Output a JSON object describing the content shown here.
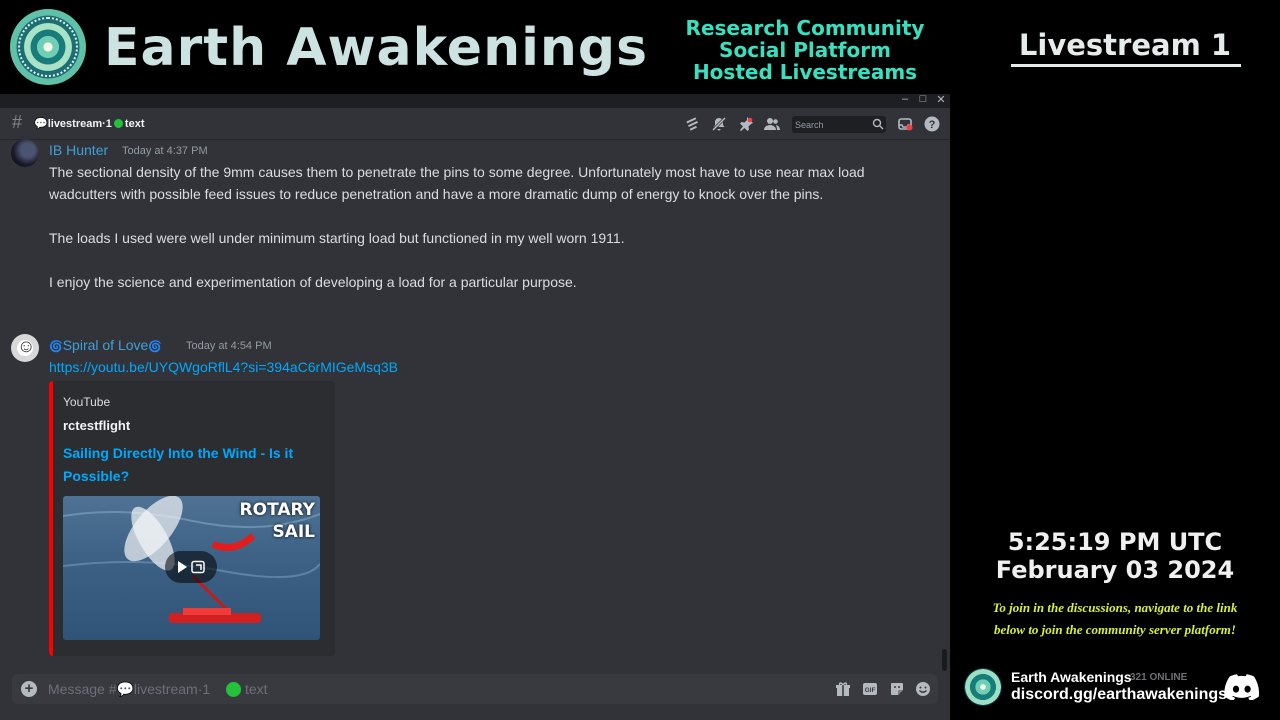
{
  "banner": {
    "brand": "Earth Awakenings",
    "tagline": [
      "Research Community",
      "Social Platform",
      "Hosted Livestreams"
    ]
  },
  "side": {
    "livestream_title": "Livestream 1",
    "time": "5:25:19 PM UTC",
    "date": "February 03 2024",
    "join_line1": "To join in the discussions, navigate to the link",
    "join_line2": "below to join the community server platform!",
    "invite": {
      "server_name": "Earth Awakenings",
      "online": "321 ONLINE",
      "url": "discord.gg/earthawakenings"
    }
  },
  "window_controls": [
    "–",
    "□",
    "✕"
  ],
  "header": {
    "channel_name": "livestream·1",
    "channel_suffix": "text",
    "search_placeholder": "Search",
    "icons": [
      "threads-icon",
      "mute-icon",
      "pin-icon",
      "members-icon",
      "inbox-icon",
      "help-icon"
    ]
  },
  "messages": [
    {
      "author": "IB Hunter",
      "timestamp": "Today at 4:37 PM",
      "paragraphs": [
        "The sectional density of the 9mm causes them to penetrate the pins to some degree.  Unfortunately most have to use near max load wadcutters with possible feed issues to reduce penetration and have a more dramatic dump of energy to knock over the pins.",
        "The loads I used were well under minimum starting load but functioned in my well worn 1911.",
        "I enjoy the science and experimentation of developing a load for a particular purpose."
      ]
    },
    {
      "author": "Spiral of Love",
      "timestamp": "Today at 4:54 PM",
      "link": "https://youtu.be/UYQWgoRflL4?si=394aC6rMIGeMsq3B",
      "embed": {
        "provider": "YouTube",
        "author": "rctestflight",
        "title": "Sailing Directly Into the Wind - Is it Possible?",
        "thumb_text": [
          "ROTARY",
          "SAIL"
        ]
      }
    }
  ],
  "composer": {
    "placeholder": "Message #💬livestream·1 ",
    "placeholder_suffix": "text",
    "icons": [
      "gift-icon",
      "gif-icon",
      "sticker-icon",
      "emoji-icon"
    ]
  },
  "colors": {
    "accent_link": "#00a8fc",
    "username": "#3fa0d8",
    "tagline": "#39e0c0",
    "join_text": "#d8f03a",
    "status_dot": "#23c23a",
    "embed_bar": "#ff0000"
  }
}
